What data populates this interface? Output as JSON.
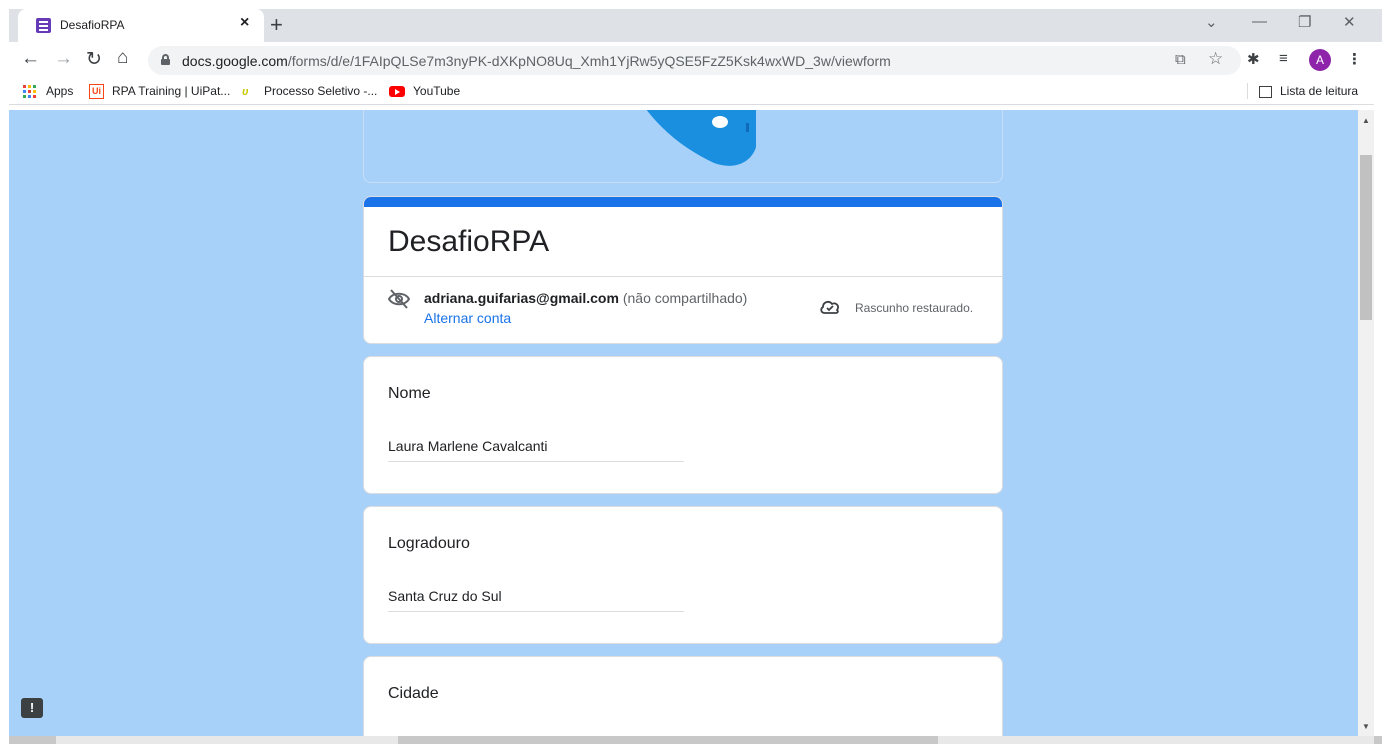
{
  "browser": {
    "tab_title": "DesafioRPA",
    "new_tab": "+",
    "tab_close": "×",
    "url_host": "docs.google.com",
    "url_path": "/forms/d/e/1FAIpQLSe7m3nyPK-dXKpNO8Uq_Xmh1YjRw5yQSE5FzZ5Ksk4wxWD_3w/viewform",
    "profile_initial": "A",
    "bookmarks": [
      "Apps",
      "RPA Training | UiPat...",
      "Processo Seletivo -...",
      "YouTube"
    ],
    "reading_list": "Lista de leitura"
  },
  "form": {
    "title": "DesafioRPA",
    "email": "adriana.guifarias@gmail.com",
    "not_shared": "(não compartilhado)",
    "switch_account": "Alternar conta",
    "draft_status": "Rascunho restaurado.",
    "questions": [
      {
        "label": "Nome",
        "value": "Laura Marlene Cavalcanti"
      },
      {
        "label": "Logradouro",
        "value": "Santa Cruz do Sul"
      },
      {
        "label": "Cidade",
        "value": ""
      }
    ]
  },
  "colors": {
    "background": "#a8d1fa",
    "accent": "#1a73e8",
    "theme": "#673ab7"
  },
  "icons": [
    "back-icon",
    "forward-icon",
    "reload-icon",
    "home-icon",
    "lock-icon",
    "share-icon",
    "star-icon",
    "extensions-icon",
    "media-icon",
    "menu-icon",
    "hidden-icon",
    "cloud-icon",
    "feedback-icon"
  ]
}
